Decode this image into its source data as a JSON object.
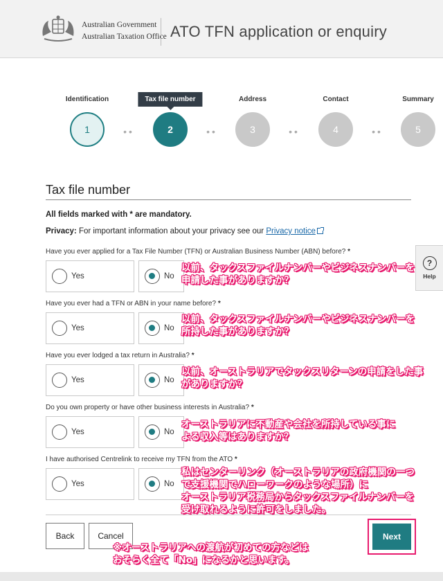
{
  "header": {
    "gov_line1": "Australian Government",
    "gov_line2": "Australian Taxation Office",
    "app_title": "ATO TFN application or enquiry"
  },
  "stepper": {
    "steps": [
      {
        "label": "Identification",
        "number": "1",
        "state": "done"
      },
      {
        "label": "Tax file number",
        "number": "2",
        "state": "current"
      },
      {
        "label": "Address",
        "number": "3",
        "state": "todo"
      },
      {
        "label": "Contact",
        "number": "4",
        "state": "todo"
      },
      {
        "label": "Summary",
        "number": "5",
        "state": "todo"
      }
    ]
  },
  "section": {
    "title": "Tax file number",
    "mandatory_note": "All fields marked with * are mandatory.",
    "privacy_label": "Privacy:",
    "privacy_text": " For important information about your privacy see our ",
    "privacy_link": "Privacy notice"
  },
  "questions": [
    {
      "text": "Have you ever applied for a Tax File Number (TFN) or Australian Business Number (ABN) before?",
      "star": "*",
      "yes": "Yes",
      "no": "No",
      "selected": "No"
    },
    {
      "text": "Have you ever had a TFN or ABN in your name before?",
      "star": "*",
      "yes": "Yes",
      "no": "No",
      "selected": "No"
    },
    {
      "text": "Have you ever lodged a tax return in Australia?",
      "star": "*",
      "yes": "Yes",
      "no": "No",
      "selected": "No"
    },
    {
      "text": "Do you own property or have other business interests in Australia?",
      "star": "*",
      "yes": "Yes",
      "no": "No",
      "selected": "No"
    },
    {
      "text": "I have authorised Centrelink to receive my TFN from the ATO",
      "star": "*",
      "yes": "Yes",
      "no": "No",
      "selected": "No"
    }
  ],
  "buttons": {
    "back": "Back",
    "cancel": "Cancel",
    "next": "Next"
  },
  "help": {
    "icon": "?",
    "label": "Help"
  },
  "annotations": {
    "q1_line1": "以前、タックスファイルナンバーやビジネスナンバーを",
    "q1_line2": "申請した事がありますか？",
    "q2_line1": "以前、タックスファイルナンバーやビジネスナンバーを",
    "q2_line2": "所持した事がありますか？",
    "q3_line1": "以前、オーストラリアでタックスリターンの申請をした事",
    "q3_line2": "がありますか？",
    "q4_line1": "オーストラリアに不動産や会社を所持している事に",
    "q4_line2": "よる収入等はありますか？",
    "q5_line1": "私はセンターリンク（オーストラリアの政府機関の一つ",
    "q5_line2": "で支援機関でハローワークのような場所）に",
    "q5_line3": "オーストラリア税務局からタックスファイルナンバーを",
    "q5_line4": "受け取れるように許可をしました。",
    "bottom_line1": "※オーストラリアへの渡航が初めての方などは",
    "bottom_line2": "おそらく全て「No」になるかと思います。"
  },
  "colors": {
    "accent": "#1f7c82",
    "annotation": "#e8196d",
    "link": "#1565a6"
  }
}
